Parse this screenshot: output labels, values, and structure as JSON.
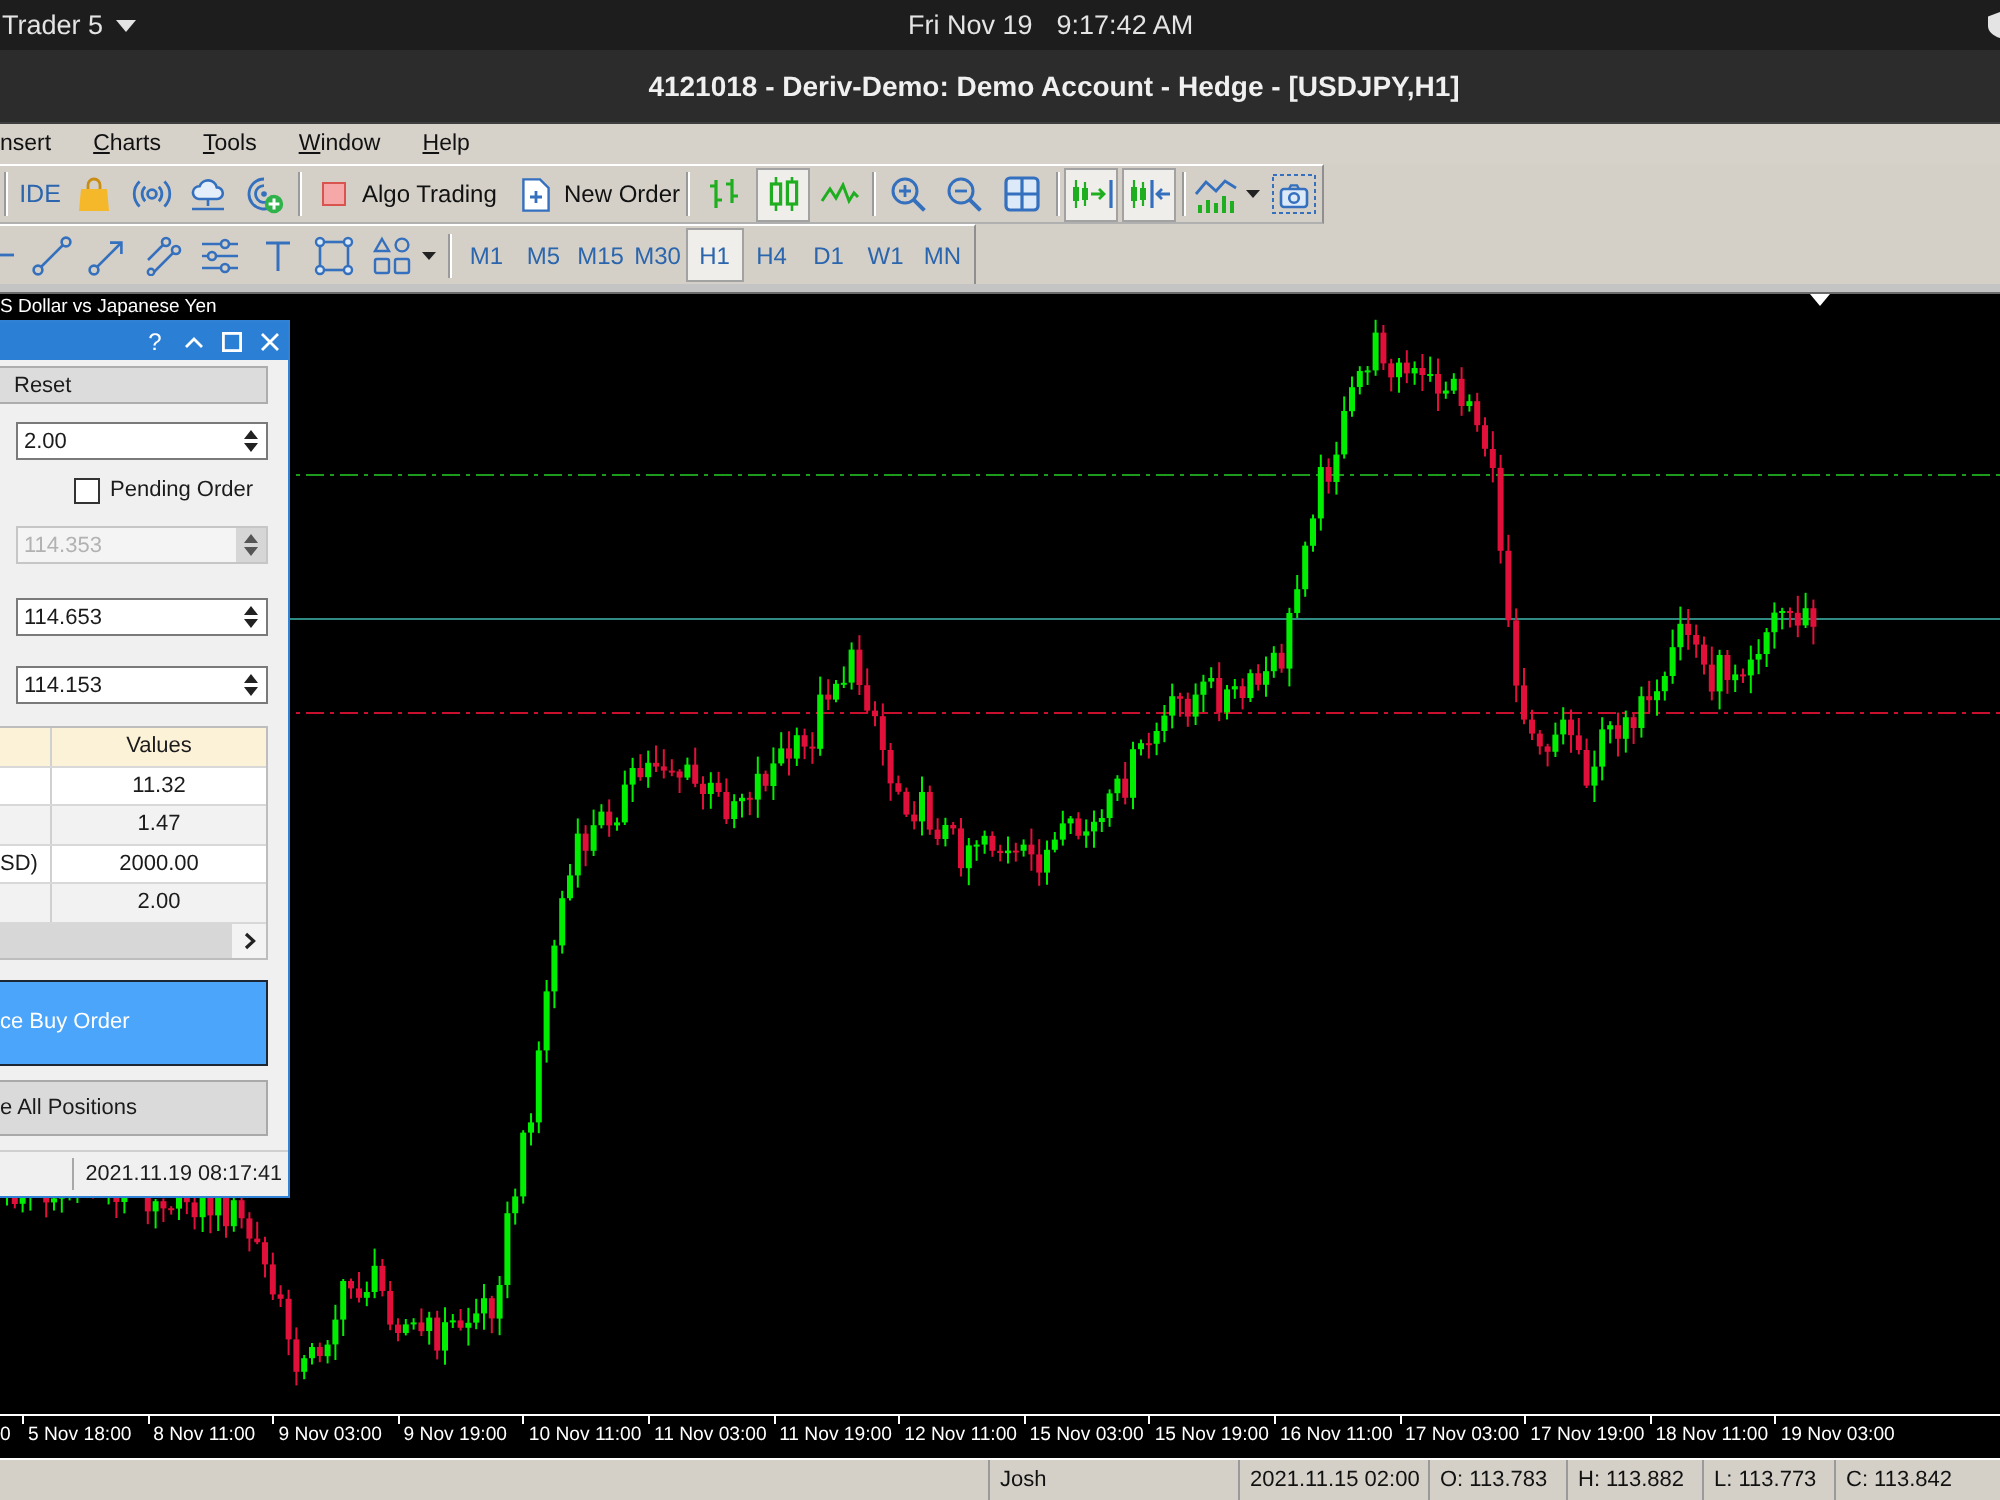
{
  "top_bar": {
    "app_name": "Trader 5",
    "date": "Fri Nov 19",
    "time": "9:17:42 AM"
  },
  "window": {
    "title": "4121018 - Deriv-Demo: Demo Account - Hedge - [USDJPY,H1]"
  },
  "menu": [
    {
      "label": "nsert",
      "mnemonic": false
    },
    {
      "label": "Charts",
      "mnemonic": true
    },
    {
      "label": "Tools",
      "mnemonic": true
    },
    {
      "label": "Window",
      "mnemonic": true
    },
    {
      "label": "Help",
      "mnemonic": true
    }
  ],
  "toolbar": {
    "ide": "IDE",
    "algo_trading": {
      "label": "Algo Trading",
      "on": false
    },
    "new_order": "New Order",
    "chart_types": [
      {
        "selected": false
      },
      {
        "selected": true
      },
      {
        "selected": false
      }
    ],
    "chart_shift": {
      "on": true
    },
    "auto_scroll": {
      "on": true
    }
  },
  "timeframes": [
    {
      "label": "M1",
      "selected": false
    },
    {
      "label": "M5",
      "selected": false
    },
    {
      "label": "M15",
      "selected": false
    },
    {
      "label": "M30",
      "selected": false
    },
    {
      "label": "H1",
      "selected": true
    },
    {
      "label": "H4",
      "selected": false
    },
    {
      "label": "D1",
      "selected": false
    },
    {
      "label": "W1",
      "selected": false
    },
    {
      "label": "MN",
      "selected": false
    }
  ],
  "chart": {
    "caption": "S Dollar vs Japanese Yen",
    "time_axis": [
      "0",
      "5 Nov 18:00",
      "8 Nov 11:00",
      "9 Nov 03:00",
      "9 Nov 19:00",
      "10 Nov 11:00",
      "11 Nov 03:00",
      "11 Nov 19:00",
      "12 Nov 11:00",
      "15 Nov 03:00",
      "15 Nov 19:00",
      "16 Nov 11:00",
      "17 Nov 03:00",
      "17 Nov 19:00",
      "18 Nov 11:00",
      "19 Nov 03:00"
    ]
  },
  "trade_panel": {
    "help": "?",
    "controls": [
      {
        "kind": "button",
        "label": "Reset"
      },
      {
        "kind": "spin",
        "value": "2.00",
        "disabled": false
      },
      {
        "kind": "checkbox",
        "label": "Pending Order",
        "checked": false
      },
      {
        "kind": "spin",
        "value": "114.353",
        "disabled": true
      },
      {
        "kind": "spin",
        "value": "114.653",
        "disabled": false
      },
      {
        "kind": "spin",
        "value": "114.153",
        "disabled": false
      }
    ],
    "table": {
      "header": {
        "column_2": "Values"
      },
      "rows": [
        {
          "column_2": "11.32"
        },
        {
          "column_2": "1.47"
        },
        {
          "column_1": "SD)",
          "column_2": "2000.00"
        },
        {
          "column_2": "2.00"
        }
      ]
    },
    "buy_button": "ce Buy Order",
    "close_button": "e All Positions",
    "time": "2021.11.19 08:17:41"
  },
  "status_bar": [
    "Josh",
    "2021.11.15 02:00",
    "O: 113.783",
    "H: 113.882",
    "L: 113.773",
    "C: 113.842"
  ]
}
